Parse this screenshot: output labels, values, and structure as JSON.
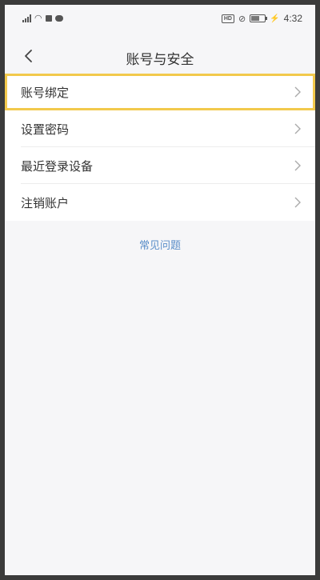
{
  "status_bar": {
    "time": "4:32",
    "hd_label": "HD",
    "battery_level": 0.6
  },
  "nav": {
    "title": "账号与安全"
  },
  "menu": {
    "items": [
      {
        "label": "账号绑定",
        "highlighted": true
      },
      {
        "label": "设置密码"
      },
      {
        "label": "最近登录设备"
      },
      {
        "label": "注销账户"
      }
    ]
  },
  "faq": {
    "label": "常见问题"
  },
  "colors": {
    "highlight_border": "#f2c94c",
    "link": "#5a8ec9",
    "background": "#f6f6f8"
  }
}
